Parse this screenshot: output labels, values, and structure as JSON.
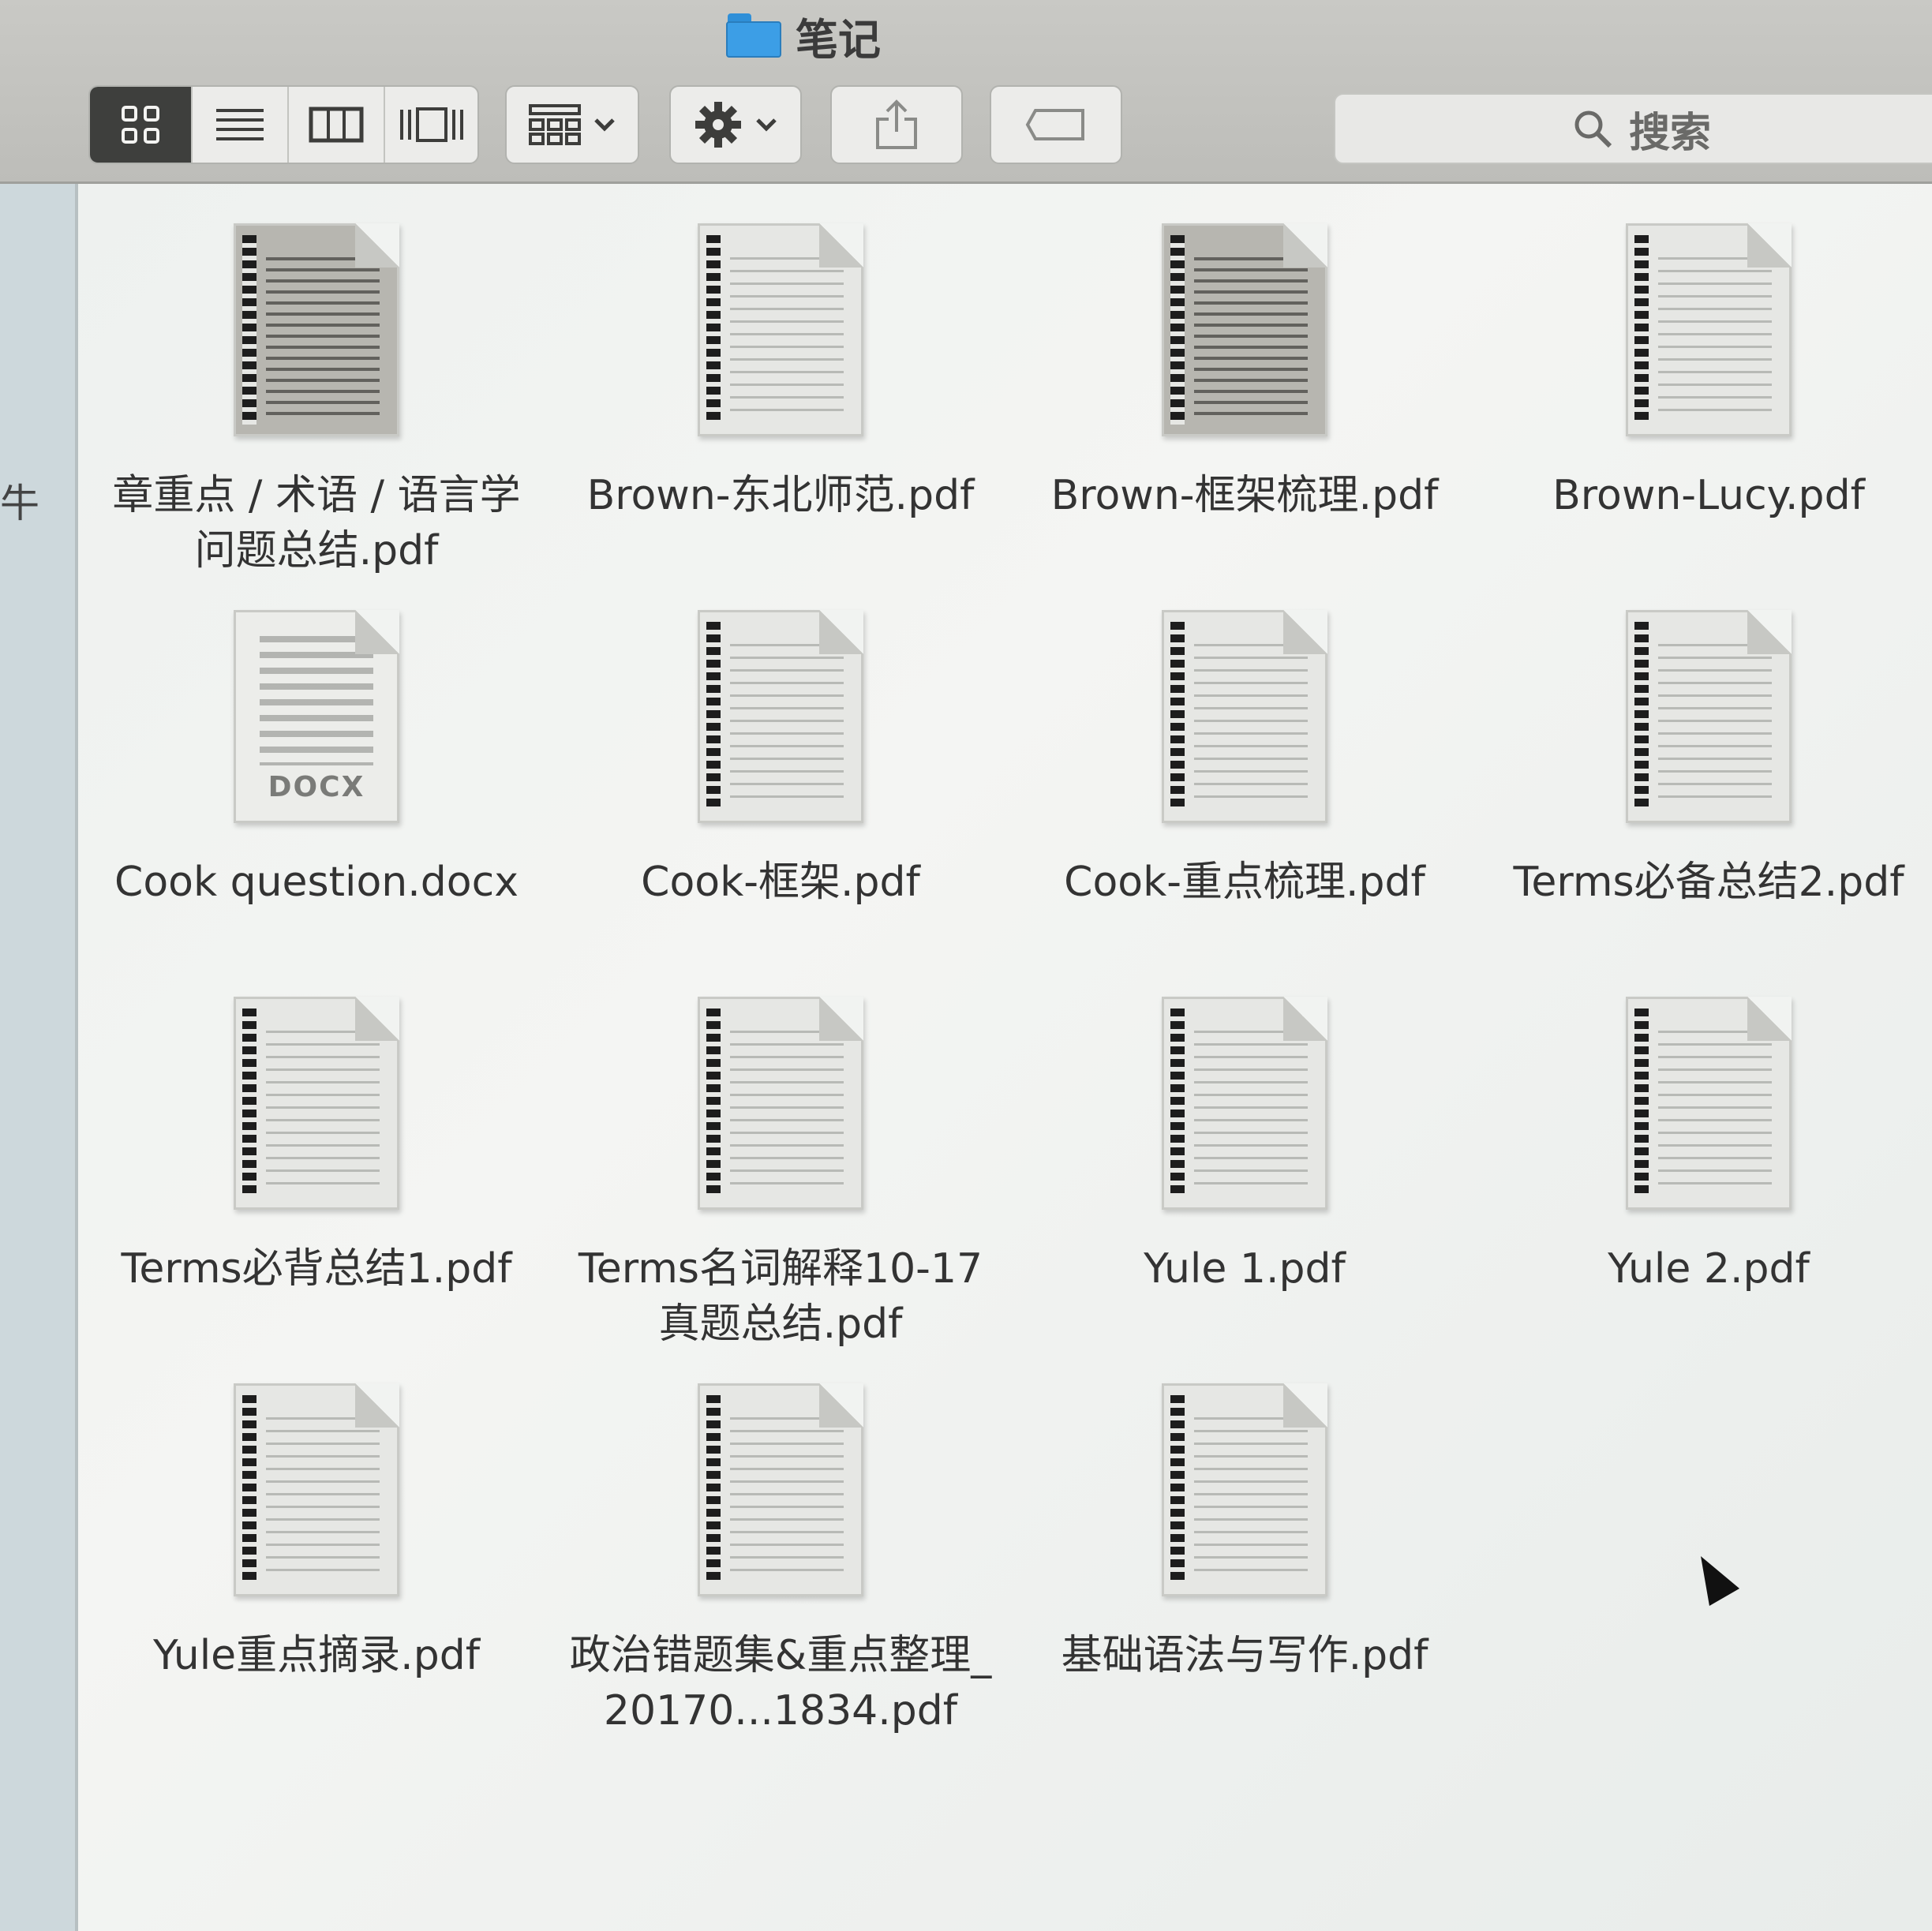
{
  "window": {
    "title": "笔记"
  },
  "toolbar": {
    "view_modes": [
      {
        "name": "icon-view",
        "icon": "grid-icon",
        "active": true
      },
      {
        "name": "list-view",
        "icon": "list-icon",
        "active": false
      },
      {
        "name": "column-view",
        "icon": "columns-icon",
        "active": false
      },
      {
        "name": "cover-flow-view",
        "icon": "cover-flow-icon",
        "active": false
      }
    ],
    "group_by": {
      "icon": "group-grid-icon",
      "dropdown": "chevron-down-icon"
    },
    "action": {
      "icon": "gear-icon",
      "dropdown": "chevron-down-icon"
    },
    "share": {
      "icon": "share-icon"
    },
    "tag": {
      "icon": "tag-icon"
    },
    "search": {
      "label": "搜索",
      "icon": "search-icon"
    }
  },
  "sidebar": {
    "fragment_1": "牛"
  },
  "files": [
    {
      "name": "章重点 / 术语 / 语言学问题总结.pdf",
      "type": "pdf",
      "thumb": "dark"
    },
    {
      "name": "Brown-东北师范.pdf",
      "type": "pdf",
      "thumb": "light"
    },
    {
      "name": "Brown-框架梳理.pdf",
      "type": "pdf",
      "thumb": "dark"
    },
    {
      "name": "Brown-Lucy.pdf",
      "type": "pdf",
      "thumb": "light"
    },
    {
      "name": "Cook question.docx",
      "type": "docx",
      "badge": "DOCX"
    },
    {
      "name": "Cook-框架.pdf",
      "type": "pdf",
      "thumb": "light"
    },
    {
      "name": "Cook-重点梳理.pdf",
      "type": "pdf",
      "thumb": "light"
    },
    {
      "name": "Terms必备总结2.pdf",
      "type": "pdf",
      "thumb": "light"
    },
    {
      "name": "Terms必背总结1.pdf",
      "type": "pdf",
      "thumb": "light"
    },
    {
      "name": "Terms名词解释10-17真题总结.pdf",
      "type": "pdf",
      "thumb": "light"
    },
    {
      "name": "Yule 1.pdf",
      "type": "pdf",
      "thumb": "light"
    },
    {
      "name": "Yule 2.pdf",
      "type": "pdf",
      "thumb": "light"
    },
    {
      "name": "Yule重点摘录.pdf",
      "type": "pdf",
      "thumb": "light"
    },
    {
      "name": "政治错题集&重点整理_20170...1834.pdf",
      "type": "pdf",
      "thumb": "light"
    },
    {
      "name": "基础语法与写作.pdf",
      "type": "pdf",
      "thumb": "light"
    }
  ]
}
